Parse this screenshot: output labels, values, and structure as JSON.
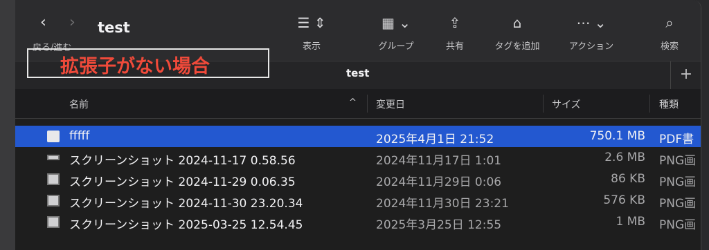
{
  "window": {
    "title": "test",
    "nav_label": "戻る/進む"
  },
  "toolbar": [
    {
      "label": "表示",
      "icon": "list-view-icon",
      "glyph": "☰ ⇕"
    },
    {
      "label": "グループ",
      "icon": "group-icon",
      "glyph": "▦ ⌄"
    },
    {
      "label": "共有",
      "icon": "share-icon",
      "glyph": "⇪"
    },
    {
      "label": "タグを追加",
      "icon": "tag-icon",
      "glyph": "⌂"
    },
    {
      "label": "アクション",
      "icon": "action-icon",
      "glyph": "⋯ ⌄"
    },
    {
      "label": "検索",
      "icon": "search-icon",
      "glyph": "⌕"
    }
  ],
  "tab": {
    "label": "test",
    "add_glyph": "+"
  },
  "annotation": {
    "text": "拡張子がない場合",
    "color": "#f04a3a"
  },
  "columns": {
    "name": "名前",
    "date": "変更日",
    "size": "サイズ",
    "kind": "種類"
  },
  "files": [
    {
      "name": "fffff",
      "date": "2025年4月1日 21:52",
      "size": "750.1 MB",
      "kind": "PDF書",
      "selected": true,
      "icon": "document-icon"
    },
    {
      "name": "スクリーンショット 2024-11-17 0.58.56",
      "date": "2024年11月17日 1:01",
      "size": "2.6 MB",
      "kind": "PNG画",
      "selected": false,
      "icon": "image-icon"
    },
    {
      "name": "スクリーンショット 2024-11-29 0.06.35",
      "date": "2024年11月29日 0:06",
      "size": "86 KB",
      "kind": "PNG画",
      "selected": false,
      "icon": "image-icon"
    },
    {
      "name": "スクリーンショット 2024-11-30 23.20.34",
      "date": "2024年11月30日 23:21",
      "size": "576 KB",
      "kind": "PNG画",
      "selected": false,
      "icon": "image-icon"
    },
    {
      "name": "スクリーンショット 2025-03-25 12.54.45",
      "date": "2025年3月25日 12:55",
      "size": "1 MB",
      "kind": "PNG画",
      "selected": false,
      "icon": "image-icon"
    }
  ],
  "colors": {
    "selection": "#2358d0",
    "background": "#1e1e1e"
  }
}
